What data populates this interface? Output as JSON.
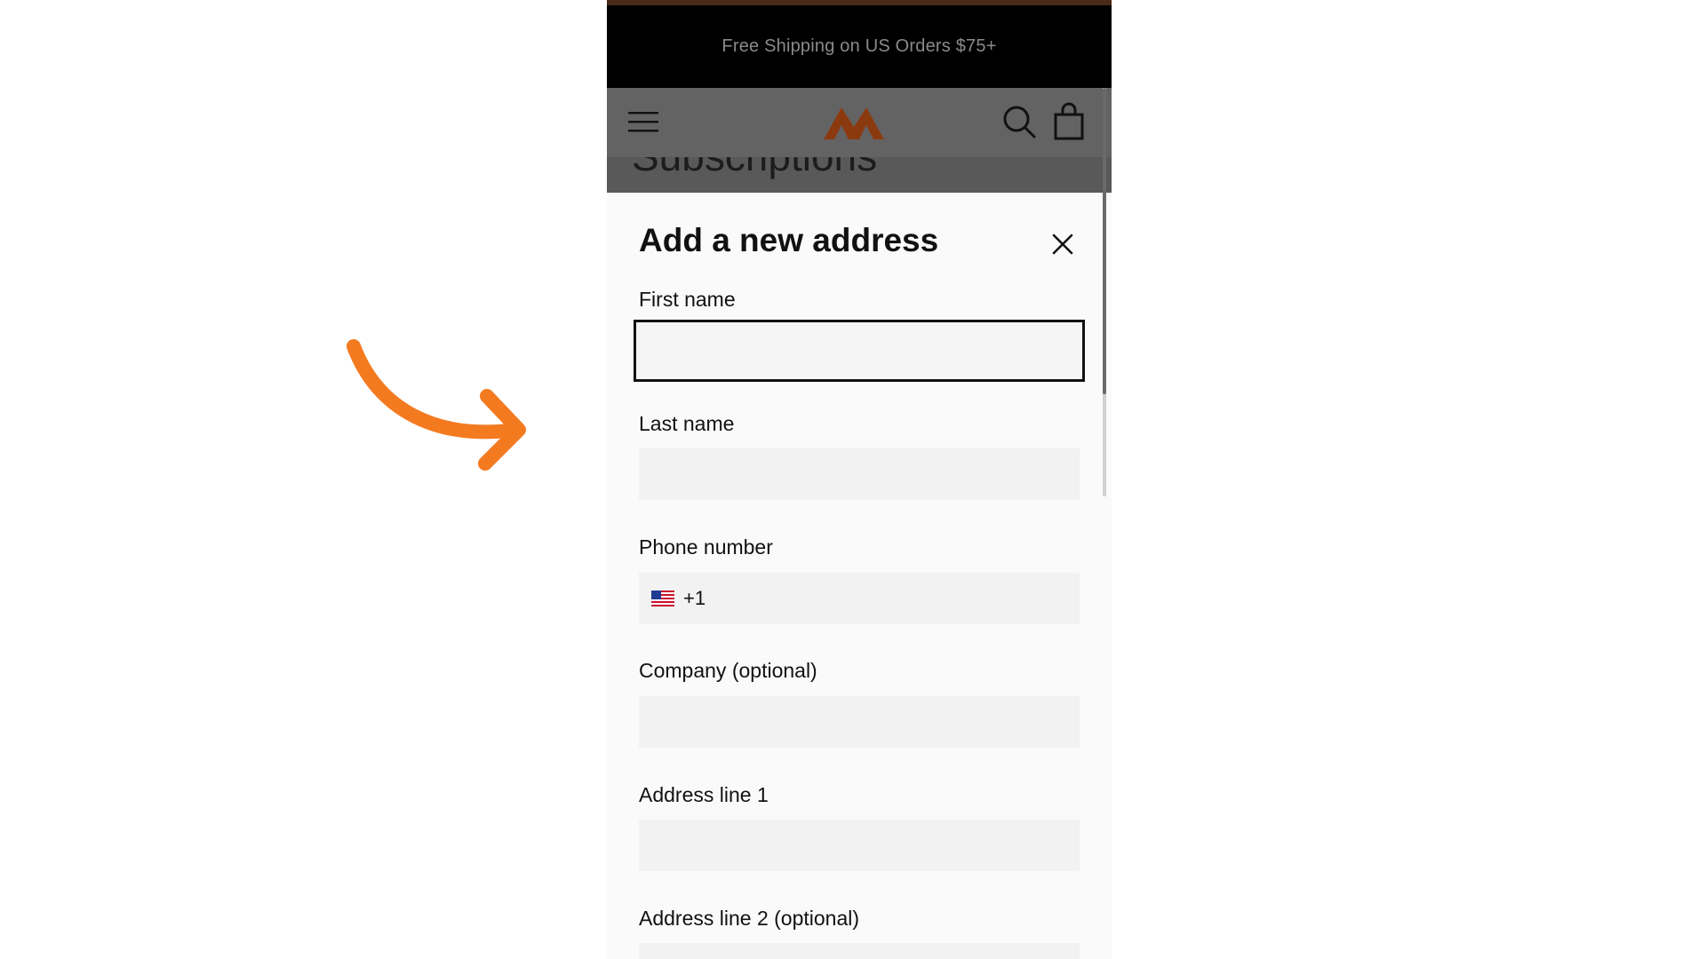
{
  "announcement": {
    "text": "Free Shipping on US Orders $75+"
  },
  "page_behind": {
    "title_peek": "Subscriptions"
  },
  "header": {
    "menu_icon": "hamburger-menu-icon",
    "logo_icon": "mountain-logo-icon",
    "search_icon": "search-icon",
    "cart_icon": "shopping-bag-icon"
  },
  "modal": {
    "title": "Add a new address",
    "close_icon": "close-icon",
    "fields": {
      "first_name": {
        "label": "First name",
        "value": ""
      },
      "last_name": {
        "label": "Last name",
        "value": ""
      },
      "phone": {
        "label": "Phone number",
        "country_flag": "us-flag-icon",
        "dial_code": "+1",
        "value": ""
      },
      "company": {
        "label": "Company (optional)",
        "value": ""
      },
      "address1": {
        "label": "Address line 1",
        "value": ""
      },
      "address2": {
        "label": "Address line 2 (optional)",
        "value": ""
      }
    }
  },
  "annotation": {
    "icon": "curved-arrow-icon",
    "color": "#f47a20"
  },
  "colors": {
    "brand_logo": "#8b3a10",
    "announcement_bg": "#000000",
    "overlay_header": "#636363",
    "input_bg": "#f2f2f2",
    "annotation_arrow": "#f47a20"
  }
}
